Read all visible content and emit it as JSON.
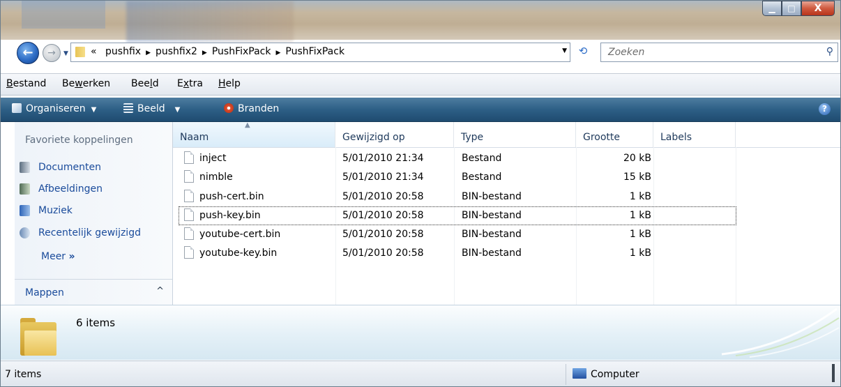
{
  "window": {
    "caption_buttons": {
      "minimize": "▁",
      "maximize": "□",
      "close": "X"
    }
  },
  "address": {
    "back_glyph": "←",
    "forward_glyph": "→",
    "overflow": "«",
    "crumbs": [
      "pushfix",
      "pushfix2",
      "PushFixPack",
      "PushFixPack"
    ]
  },
  "search": {
    "placeholder": "Zoeken",
    "icon": "magnifier-icon"
  },
  "menu": {
    "items": [
      {
        "label": "Bestand",
        "underline": "B",
        "rest": "estand"
      },
      {
        "label": "Bewerken",
        "pre": "Be",
        "underline": "w",
        "rest": "erken"
      },
      {
        "label": "Beeld",
        "pre": "Bee",
        "underline": "l",
        "rest": "d"
      },
      {
        "label": "Extra",
        "pre": "E",
        "underline": "x",
        "rest": "tra"
      },
      {
        "label": "Help",
        "underline": "H",
        "rest": "elp"
      }
    ]
  },
  "toolbar": {
    "organise": "Organiseren",
    "view": "Beeld",
    "burn": "Branden",
    "help": "?"
  },
  "nav": {
    "favorites_title": "Favoriete koppelingen",
    "links": [
      "Documenten",
      "Afbeeldingen",
      "Muziek",
      "Recentelijk gewijzigd"
    ],
    "more": "Meer",
    "more_glyph": "»",
    "folders": "Mappen",
    "folders_chevron": "^"
  },
  "columns": {
    "name": "Naam",
    "modified": "Gewijzigd op",
    "type": "Type",
    "size": "Grootte",
    "labels": "Labels"
  },
  "files": [
    {
      "name": "inject",
      "modified": "5/01/2010 21:34",
      "type": "Bestand",
      "size": "20 kB"
    },
    {
      "name": "nimble",
      "modified": "5/01/2010 21:34",
      "type": "Bestand",
      "size": "15 kB"
    },
    {
      "name": "push-cert.bin",
      "modified": "5/01/2010 20:58",
      "type": "BIN-bestand",
      "size": "1 kB"
    },
    {
      "name": "push-key.bin",
      "modified": "5/01/2010 20:58",
      "type": "BIN-bestand",
      "size": "1 kB"
    },
    {
      "name": "youtube-cert.bin",
      "modified": "5/01/2010 20:58",
      "type": "BIN-bestand",
      "size": "1 kB"
    },
    {
      "name": "youtube-key.bin",
      "modified": "5/01/2010 20:58",
      "type": "BIN-bestand",
      "size": "1 kB"
    }
  ],
  "details": {
    "count": "6 items"
  },
  "status": {
    "items": "7 items",
    "zone": "Computer"
  },
  "colors": {
    "toolbar": "#2d5f86",
    "link": "#1a4b9b",
    "header_text": "#1e395b"
  }
}
